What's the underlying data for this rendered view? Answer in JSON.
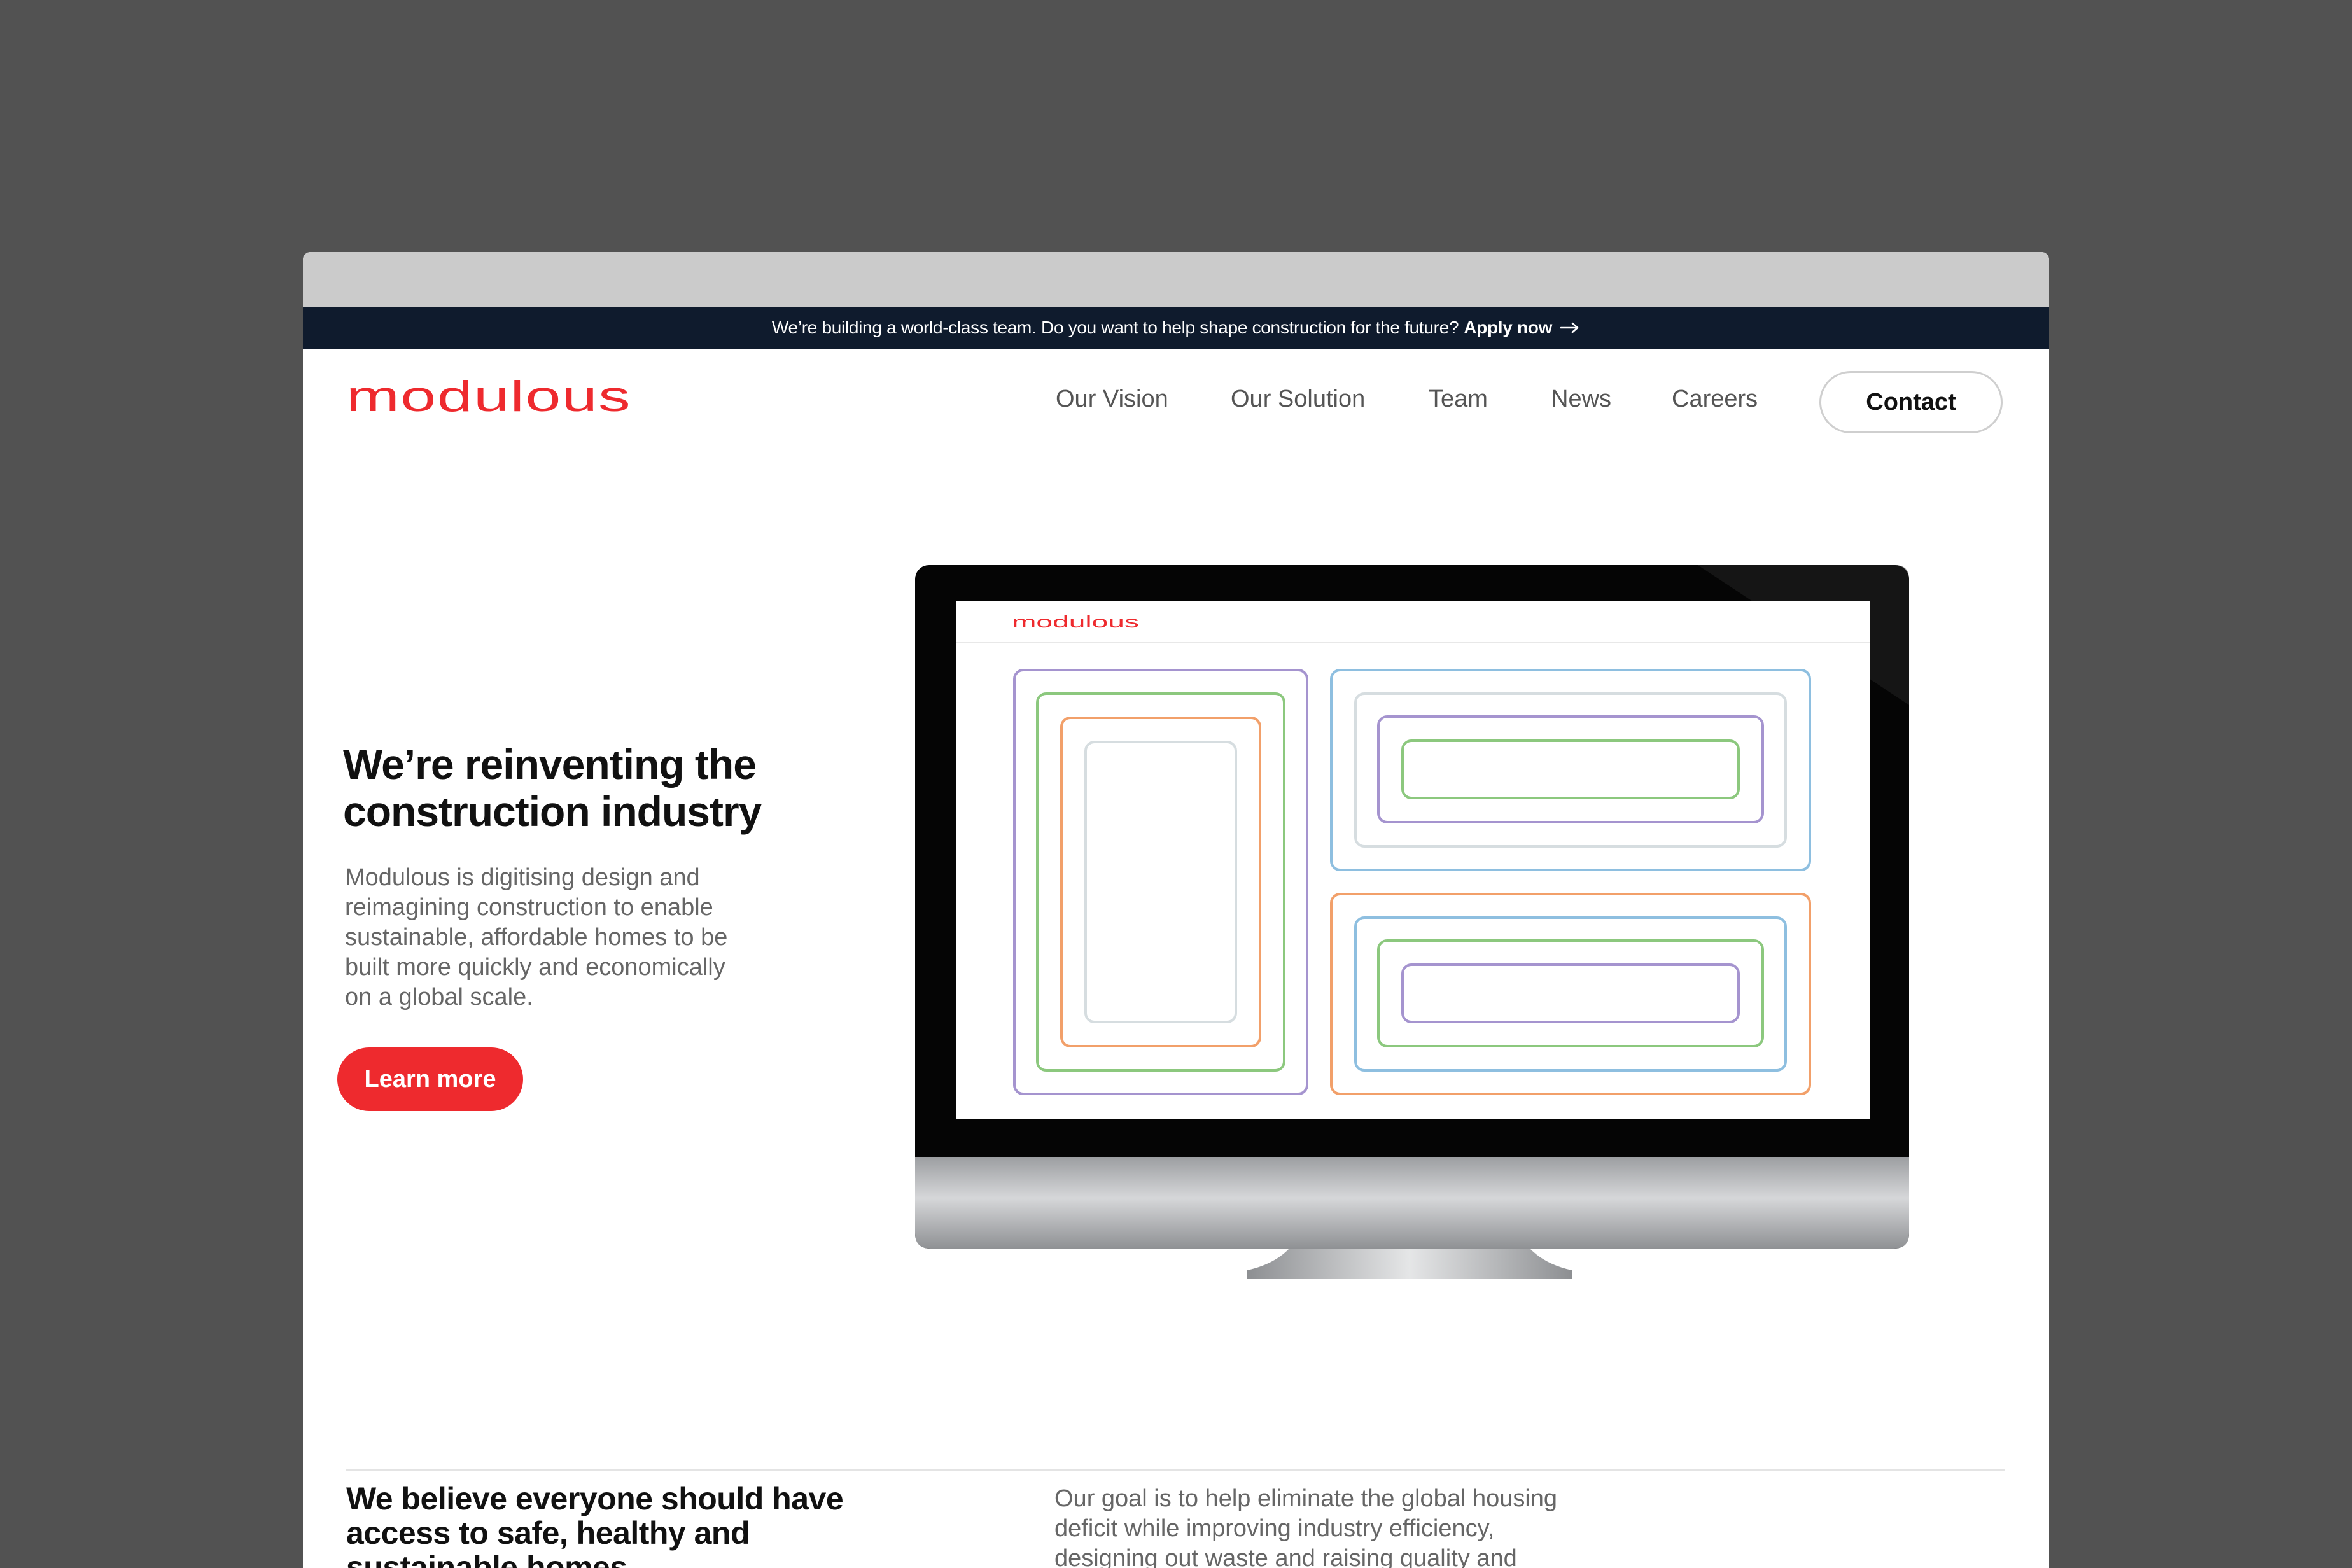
{
  "banner": {
    "text": "We’re building a world-class team. Do you want to help shape construction for the future?",
    "cta": "Apply now"
  },
  "brand": {
    "name": "modulous",
    "accent": "#ee2a2e",
    "dark": "#0f1b2d"
  },
  "nav": {
    "items": [
      "Our Vision",
      "Our Solution",
      "Team",
      "News",
      "Careers"
    ],
    "contact": "Contact"
  },
  "hero": {
    "title": "We’re reinventing the construction industry",
    "description": "Modulous is digitising design and reimagining construction to enable sustainable, affordable homes to be built more quickly and economically on a global scale.",
    "cta": "Learn more"
  },
  "mission": {
    "heading": "We believe everyone should have access to safe, healthy and sustainable homes",
    "text": "Our goal is to help eliminate the global housing deficit while improving industry efficiency, designing out waste and raising quality and"
  },
  "icons": [
    "arrow-right-icon",
    "modulous-logo",
    "imac-illustration"
  ]
}
